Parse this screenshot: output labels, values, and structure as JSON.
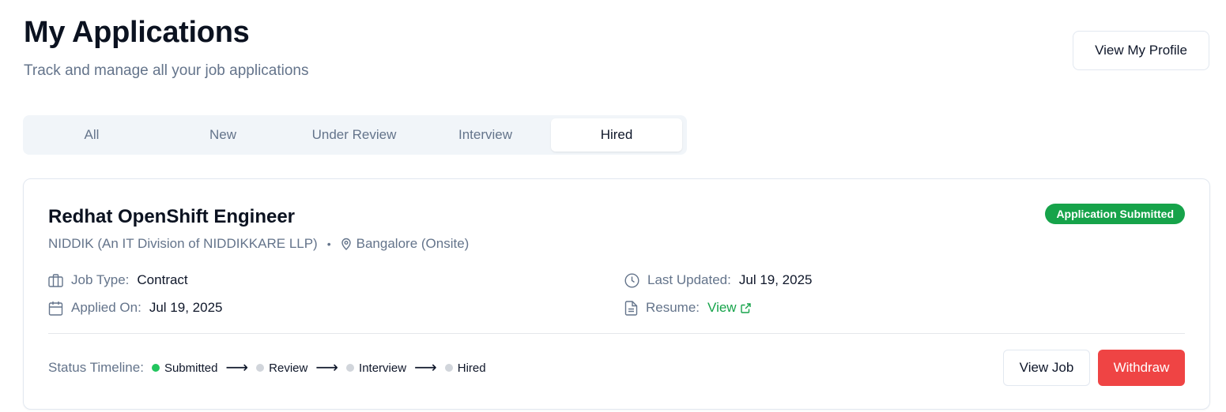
{
  "header": {
    "title": "My Applications",
    "subtitle": "Track and manage all your job applications",
    "profile_button": "View My Profile"
  },
  "tabs": [
    {
      "label": "All",
      "active": false
    },
    {
      "label": "New",
      "active": false
    },
    {
      "label": "Under Review",
      "active": false
    },
    {
      "label": "Interview",
      "active": false
    },
    {
      "label": "Hired",
      "active": true
    }
  ],
  "application": {
    "title": "Redhat OpenShift Engineer",
    "status": "Application Submitted",
    "company": "NIDDIK (An IT Division of NIDDIKKARE LLP)",
    "separator": "•",
    "location": "Bangalore (Onsite)",
    "job_type_label": "Job Type:",
    "job_type_value": "Contract",
    "applied_label": "Applied On:",
    "applied_value": "Jul 19, 2025",
    "updated_label": "Last Updated:",
    "updated_value": "Jul 19, 2025",
    "resume_label": "Resume:",
    "resume_link": "View",
    "timeline_label": "Status Timeline:",
    "timeline_steps": [
      {
        "label": "Submitted",
        "done": true
      },
      {
        "label": "Review",
        "done": false
      },
      {
        "label": "Interview",
        "done": false
      },
      {
        "label": "Hired",
        "done": false
      }
    ],
    "arrow": "⟶",
    "view_job_button": "View Job",
    "withdraw_button": "Withdraw"
  },
  "colors": {
    "accent_green": "#16a34a",
    "danger_red": "#ef4444",
    "muted_text": "#64748b"
  }
}
